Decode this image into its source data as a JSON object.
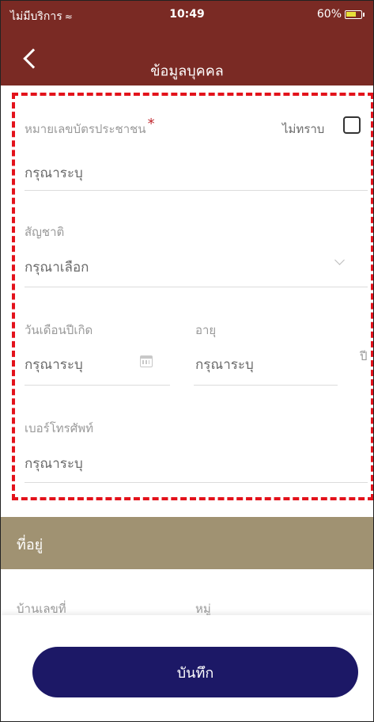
{
  "status_bar": {
    "carrier": "ไม่มีบริการ",
    "time": "10:49",
    "battery": "60%"
  },
  "nav": {
    "title": "ข้อมูลบุคคล"
  },
  "form": {
    "id_card": {
      "label": "หมายเลขบัตรประชาชน",
      "required_mark": "*",
      "unknown_label": "ไม่ทราบ",
      "unknown_checked": false,
      "placeholder": "กรุณาระบุ"
    },
    "nationality": {
      "label": "สัญชาติ",
      "placeholder": "กรุณาเลือก"
    },
    "birth_date": {
      "label": "วันเดือนปีเกิด",
      "placeholder": "กรุณาระบุ"
    },
    "age": {
      "label": "อายุ",
      "placeholder": "กรุณาระบุ",
      "unit": "ปี"
    },
    "phone": {
      "label": "เบอร์โทรศัพท์",
      "placeholder": "กรุณาระบุ"
    }
  },
  "address": {
    "title": "ที่อยู่",
    "house_no_label": "บ้านเลขที่",
    "moo_label": "หมู่"
  },
  "actions": {
    "save": "บันทึก"
  },
  "colors": {
    "header": "#7a2a24",
    "section": "#a09272",
    "button": "#1c1866",
    "highlight": "#e3121b"
  }
}
